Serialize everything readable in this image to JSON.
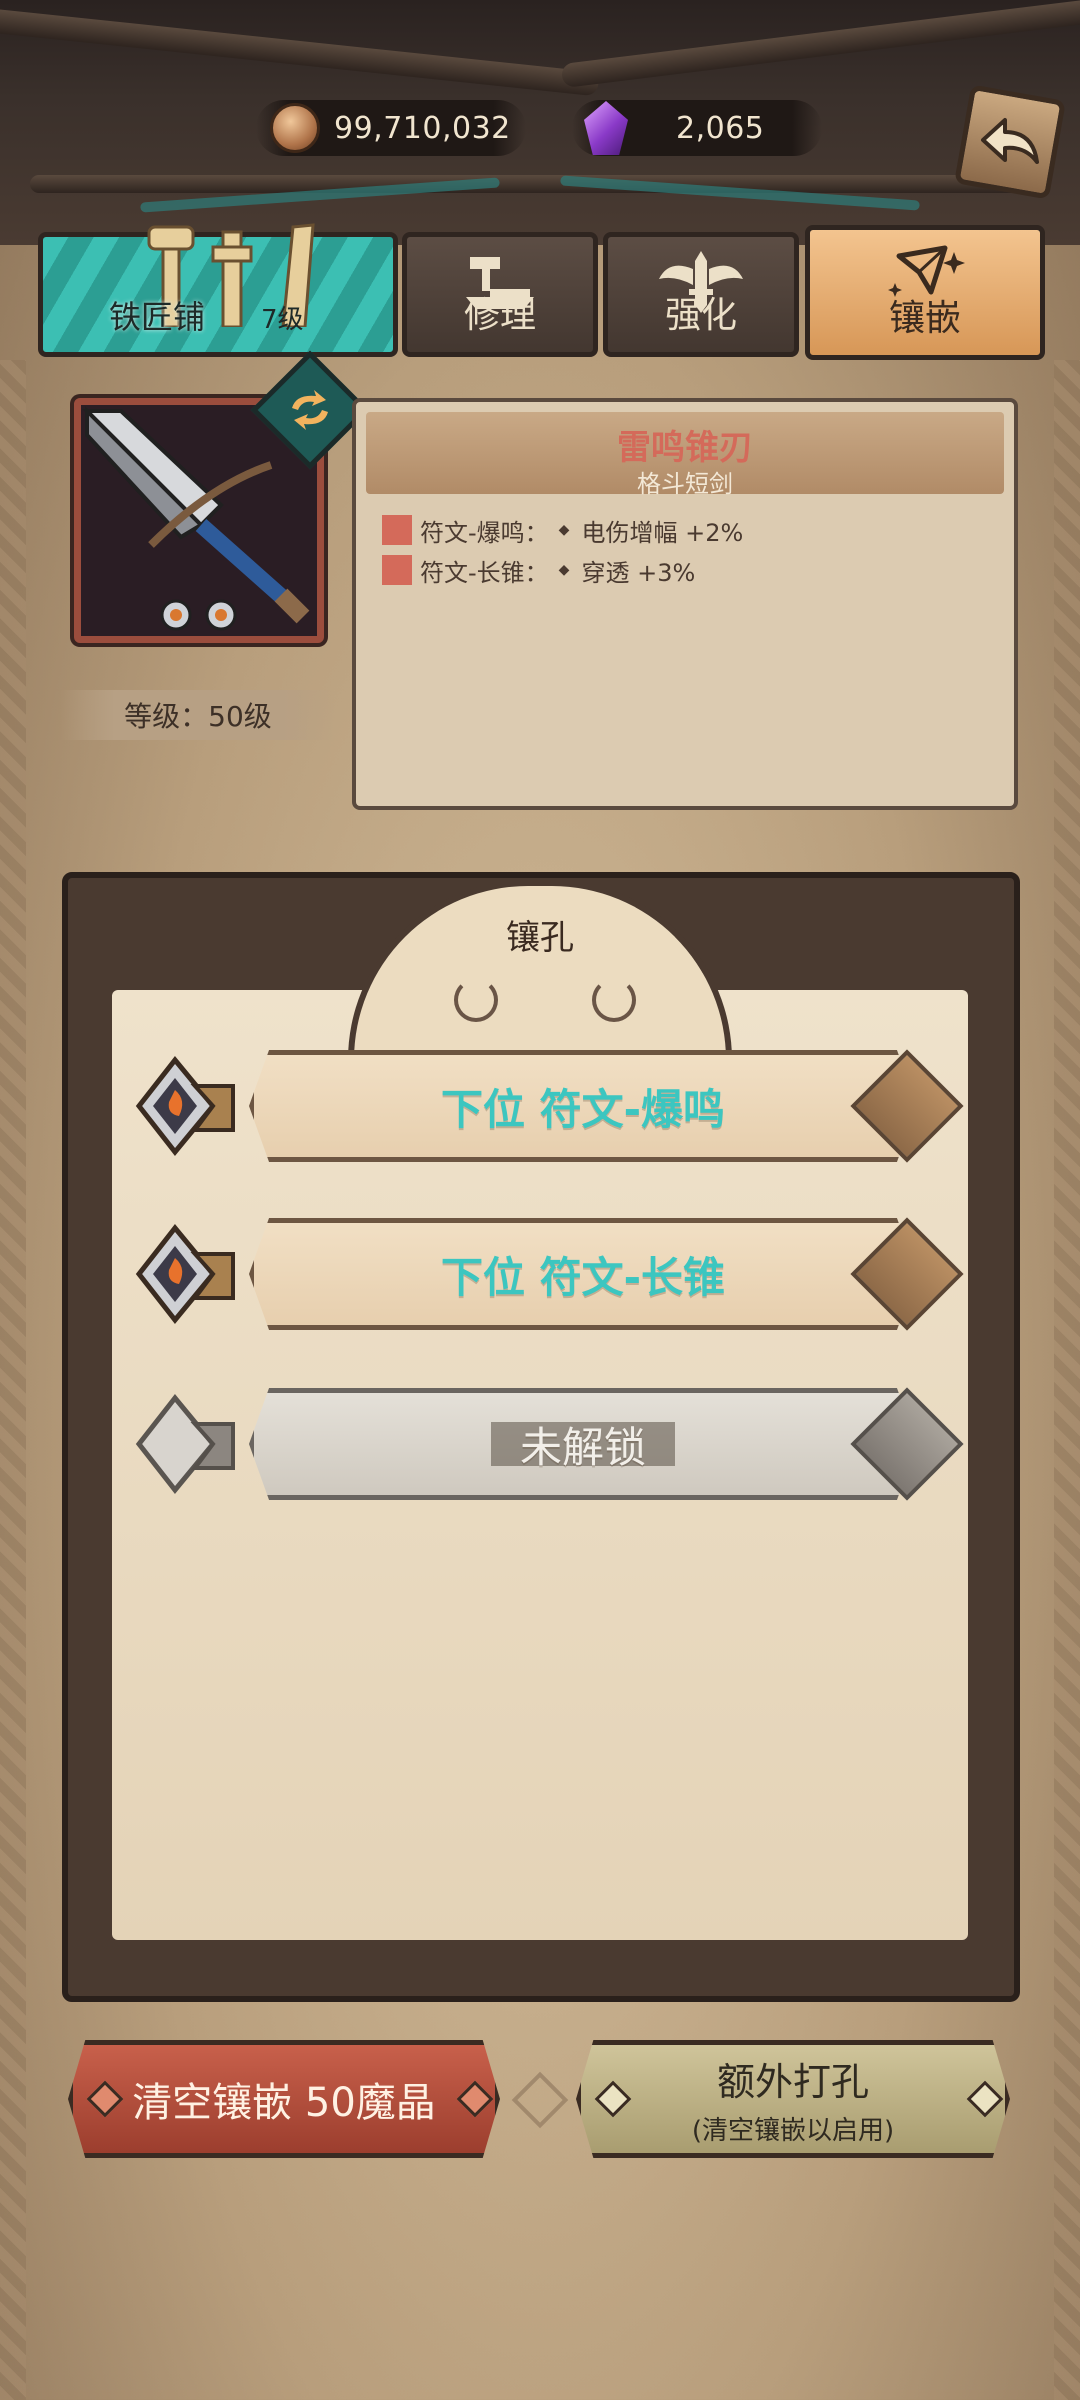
{
  "currency": {
    "coins": "99,710,032",
    "gems": "2,065"
  },
  "tabs": {
    "shop_name": "铁匠铺",
    "shop_level": "7级",
    "repair": "修理",
    "enhance": "强化",
    "inlay": "镶嵌"
  },
  "item": {
    "name": "雷鸣锥刃",
    "type": "格斗短剑",
    "level": "等级：50级",
    "stats": [
      {
        "rune": "符文-爆鸣：",
        "effect": "电伤增幅 +2%"
      },
      {
        "rune": "符文-长锥：",
        "effect": "穿透 +3%"
      }
    ]
  },
  "sockets": {
    "title": "镶孔",
    "slots": [
      {
        "label": "下位 符文-爆鸣",
        "state": "filled"
      },
      {
        "label": "下位 符文-长锥",
        "state": "filled"
      },
      {
        "label": "未解锁",
        "state": "locked"
      }
    ]
  },
  "buttons": {
    "clear": "清空镶嵌 50魔晶",
    "extra_title": "额外打孔",
    "extra_sub": "(清空镶嵌以启用)"
  },
  "colors": {
    "rune_name": "#3cc6c0",
    "item_name": "#d46a5a",
    "active_tab": "#e6ad72",
    "shop_tab": "#3cbfb3"
  },
  "icons": [
    "coin-icon",
    "gem-icon",
    "back-arrow-icon",
    "anvil-hammer-icon",
    "winged-sword-icon",
    "sparkle-star-icon",
    "swap-arrows-icon",
    "rune-gem-icon"
  ]
}
